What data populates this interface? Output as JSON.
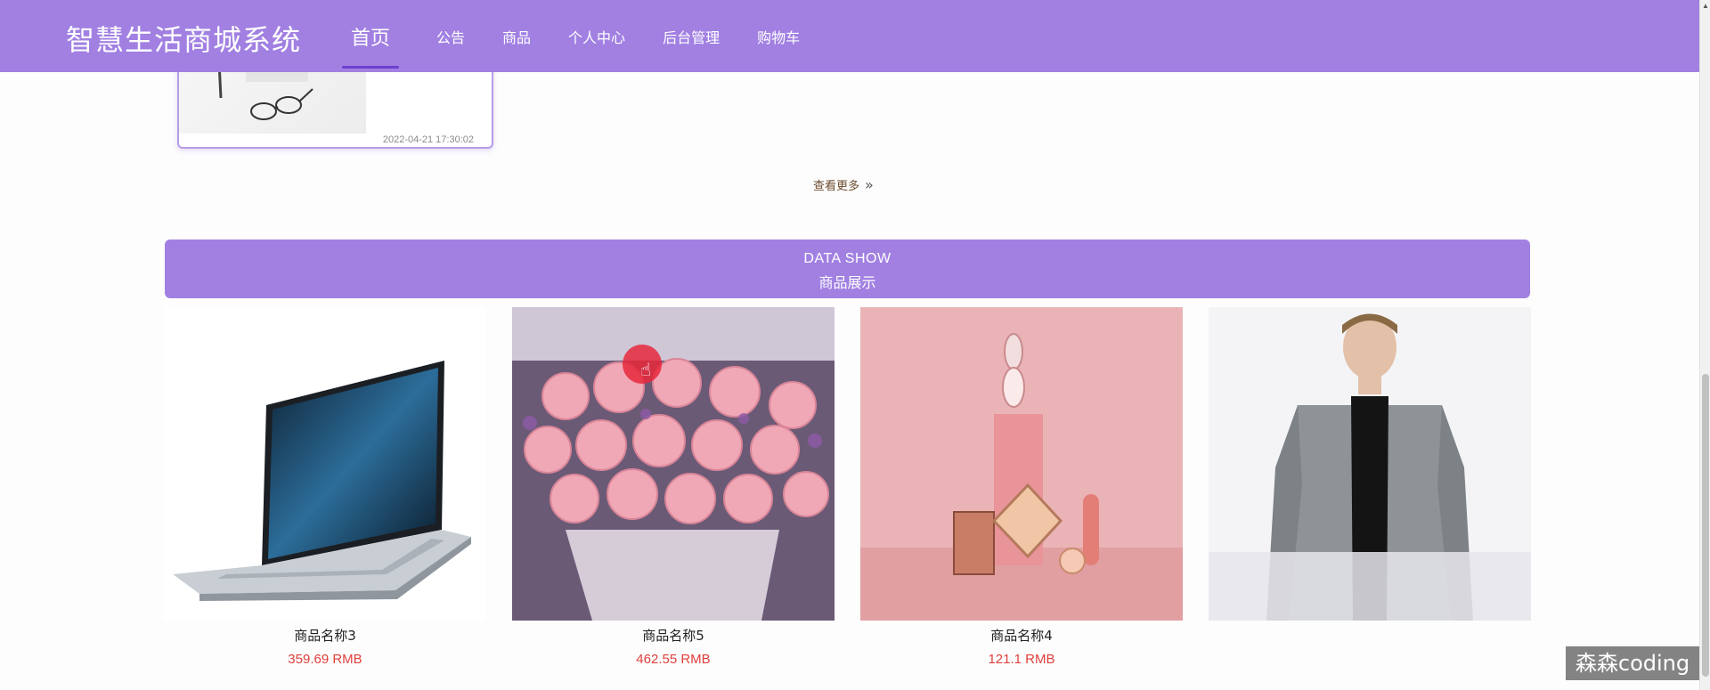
{
  "header": {
    "brand": "智慧生活商城系统",
    "nav": [
      {
        "label": "首页",
        "active": true
      },
      {
        "label": "公告"
      },
      {
        "label": "商品"
      },
      {
        "label": "个人中心"
      },
      {
        "label": "后台管理"
      },
      {
        "label": "购物车"
      }
    ]
  },
  "previous_card": {
    "timestamp": "2022-04-21 17:30:02"
  },
  "view_more": {
    "label": "查看更多",
    "icon": "double-chevron-right-icon"
  },
  "section": {
    "title_en": "DATA SHOW",
    "title_cn": "商品展示"
  },
  "products": [
    {
      "name": "商品名称3",
      "price": "359.69 RMB",
      "image": "laptop"
    },
    {
      "name": "商品名称5",
      "price": "462.55 RMB",
      "image": "pink-roses-bouquet"
    },
    {
      "name": "商品名称4",
      "price": "121.1 RMB",
      "image": "cosmetics-display"
    },
    {
      "name": "",
      "price": "",
      "image": "grey-jacket-model"
    }
  ],
  "watermark": "森森coding",
  "colors": {
    "primary": "#a180e2",
    "price": "#e0403c",
    "active_underline": "#6d3fcf"
  }
}
